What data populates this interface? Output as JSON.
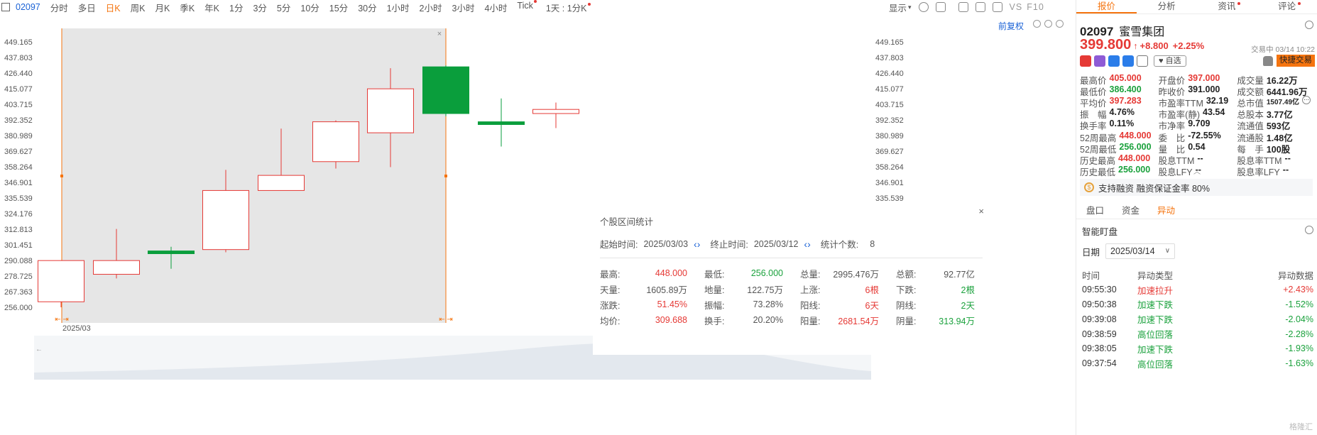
{
  "toolbar": {
    "stock_code": "02097",
    "periods": [
      "分时",
      "多日",
      "日K",
      "周K",
      "月K",
      "季K",
      "年K",
      "1分",
      "3分",
      "5分",
      "10分",
      "15分",
      "30分",
      "1小时",
      "2小时",
      "3小时",
      "4小时",
      "Tick",
      "1天 : 1分K"
    ],
    "active_period": "日K",
    "display_label": "显示",
    "vs_label": "VS",
    "f10_label": "F10"
  },
  "chart": {
    "front_adjust_label": "前复权",
    "date_label": "2025/03",
    "close_symbol": "×"
  },
  "chart_data": {
    "type": "candlestick",
    "y_ticks": [
      "449.165",
      "437.803",
      "426.440",
      "415.077",
      "403.715",
      "392.352",
      "380.989",
      "369.627",
      "358.264",
      "346.901",
      "335.539",
      "324.176",
      "312.813",
      "301.451",
      "290.088",
      "278.725",
      "267.363",
      "256.000"
    ],
    "ylim": [
      256.0,
      449.165
    ],
    "x_label": "2025/03",
    "selection": {
      "start_index": 0,
      "end_index": 8
    },
    "candles": [
      {
        "open": 260.0,
        "close": 290.0,
        "high": 290.0,
        "low": 256.0,
        "direction": "up"
      },
      {
        "open": 280.0,
        "close": 290.0,
        "high": 313.0,
        "low": 277.0,
        "direction": "up"
      },
      {
        "open": 297.0,
        "close": 295.0,
        "high": 300.0,
        "low": 284.0,
        "direction": "down"
      },
      {
        "open": 298.0,
        "close": 341.0,
        "high": 356.0,
        "low": 296.0,
        "direction": "up"
      },
      {
        "open": 341.0,
        "close": 352.0,
        "high": 386.0,
        "low": 341.0,
        "direction": "up"
      },
      {
        "open": 362.0,
        "close": 391.0,
        "high": 392.0,
        "low": 357.0,
        "direction": "up"
      },
      {
        "open": 383.0,
        "close": 415.0,
        "high": 430.0,
        "low": 358.0,
        "direction": "up"
      },
      {
        "open": 431.0,
        "close": 397.0,
        "high": 432.0,
        "low": 395.0,
        "direction": "down"
      },
      {
        "open": 391.0,
        "close": 389.0,
        "high": 408.0,
        "low": 373.0,
        "direction": "down"
      },
      {
        "open": 397.0,
        "close": 400.0,
        "high": 405.0,
        "low": 386.4,
        "direction": "up"
      }
    ]
  },
  "stats": {
    "title": "个股区间统计",
    "close_symbol": "×",
    "start_label": "起始时间:",
    "start_value": "2025/03/03",
    "end_label": "终止时间:",
    "end_value": "2025/03/12",
    "count_label": "统计个数:",
    "count_value": "8",
    "rows": [
      [
        {
          "label": "最高:",
          "value": "448.000",
          "color": "red"
        },
        {
          "label": "最低:",
          "value": "256.000",
          "color": "green"
        },
        {
          "label": "总量:",
          "value": "2995.476万",
          "color": "normal"
        },
        {
          "label": "总额:",
          "value": "92.77亿",
          "color": "normal"
        }
      ],
      [
        {
          "label": "天量:",
          "value": "1605.89万",
          "color": "normal"
        },
        {
          "label": "地量:",
          "value": "122.75万",
          "color": "normal"
        },
        {
          "label": "上涨:",
          "value": "6根",
          "color": "red"
        },
        {
          "label": "下跌:",
          "value": "2根",
          "color": "green"
        }
      ],
      [
        {
          "label": "涨跌:",
          "value": "51.45%",
          "color": "red"
        },
        {
          "label": "振幅:",
          "value": "73.28%",
          "color": "normal"
        },
        {
          "label": "阳线:",
          "value": "6天",
          "color": "red"
        },
        {
          "label": "阴线:",
          "value": "2天",
          "color": "green"
        }
      ],
      [
        {
          "label": "均价:",
          "value": "309.688",
          "color": "red"
        },
        {
          "label": "换手:",
          "value": "20.20%",
          "color": "normal"
        },
        {
          "label": "阳量:",
          "value": "2681.54万",
          "color": "red"
        },
        {
          "label": "阴量:",
          "value": "313.94万",
          "color": "green"
        }
      ]
    ]
  },
  "panel": {
    "tabs": [
      {
        "label": "报价",
        "active": true,
        "dot": false
      },
      {
        "label": "分析",
        "active": false,
        "dot": false
      },
      {
        "label": "资讯",
        "active": false,
        "dot": true
      },
      {
        "label": "评论",
        "active": false,
        "dot": true
      }
    ],
    "code": "02097",
    "name": "蜜雪集团",
    "price": "399.800",
    "arrow": "↑",
    "change": "+8.800",
    "change_pct": "+2.25%",
    "trade_status": "交易中 03/14 10:22",
    "watch_label": "♥ 自选",
    "quick_trade_label": "快捷交易",
    "quotes": [
      [
        {
          "l": "最高价",
          "v": "405.000",
          "c": "red"
        },
        {
          "l": "开盘价",
          "v": "397.000",
          "c": "red"
        },
        {
          "l": "成交量",
          "v": "16.22万",
          "c": "normal"
        }
      ],
      [
        {
          "l": "最低价",
          "v": "386.400",
          "c": "green"
        },
        {
          "l": "昨收价",
          "v": "391.000",
          "c": "normal"
        },
        {
          "l": "成交额",
          "v": "6441.96万",
          "c": "normal"
        }
      ],
      [
        {
          "l": "平均价",
          "v": "397.283",
          "c": "red"
        },
        {
          "l": "市盈率TTM",
          "v": "32.19",
          "c": "normal"
        },
        {
          "l": "总市值",
          "v": "1507.49亿",
          "c": "small"
        }
      ],
      [
        {
          "l": "振　幅",
          "v": "4.76%",
          "c": "normal"
        },
        {
          "l": "市盈率(静)",
          "v": "43.54",
          "c": "normal"
        },
        {
          "l": "总股本",
          "v": "3.77亿",
          "c": "normal"
        }
      ],
      [
        {
          "l": "换手率",
          "v": "0.11%",
          "c": "normal"
        },
        {
          "l": "市净率",
          "v": "9.709",
          "c": "normal"
        },
        {
          "l": "流通值",
          "v": "593亿",
          "c": "normal"
        }
      ],
      [
        {
          "l": "52周最高",
          "v": "448.000",
          "c": "red"
        },
        {
          "l": "委　比",
          "v": "-72.55%",
          "c": "normal"
        },
        {
          "l": "流通股",
          "v": "1.48亿",
          "c": "normal"
        }
      ],
      [
        {
          "l": "52周最低",
          "v": "256.000",
          "c": "green"
        },
        {
          "l": "量　比",
          "v": "0.54",
          "c": "normal"
        },
        {
          "l": "每　手",
          "v": "100股",
          "c": "normal"
        }
      ],
      [
        {
          "l": "历史最高",
          "v": "448.000",
          "c": "red"
        },
        {
          "l": "股息TTM",
          "v": "--",
          "c": "normal"
        },
        {
          "l": "股息率TTM",
          "v": "--",
          "c": "normal"
        }
      ],
      [
        {
          "l": "历史最低",
          "v": "256.000",
          "c": "green"
        },
        {
          "l": "股息LFY",
          "v": "--",
          "c": "normal"
        },
        {
          "l": "股息率LFY",
          "v": "--",
          "c": "normal"
        }
      ]
    ],
    "margin_text": "支持融资 融资保证金率 80%",
    "subtabs": [
      {
        "label": "盘口",
        "active": false
      },
      {
        "label": "资金",
        "active": false
      },
      {
        "label": "异动",
        "active": true
      }
    ],
    "smart_title": "智能盯盘",
    "date_label": "日期",
    "date_value": "2025/03/14",
    "alert_headers": {
      "time": "时间",
      "type": "异动类型",
      "data": "异动数据"
    },
    "alerts": [
      {
        "time": "09:55:30",
        "type": "加速拉升",
        "data": "+2.43%",
        "dir": "up"
      },
      {
        "time": "09:50:38",
        "type": "加速下跌",
        "data": "-1.52%",
        "dir": "down"
      },
      {
        "time": "09:39:08",
        "type": "加速下跌",
        "data": "-2.04%",
        "dir": "down"
      },
      {
        "time": "09:38:59",
        "type": "高位回落",
        "data": "-2.28%",
        "dir": "down"
      },
      {
        "time": "09:38:05",
        "type": "加速下跌",
        "data": "-1.93%",
        "dir": "down"
      },
      {
        "time": "09:37:54",
        "type": "高位回落",
        "data": "-1.63%",
        "dir": "down"
      }
    ],
    "watermark": "格隆汇"
  },
  "colors": {
    "up": "#e53935",
    "down": "#0a9e3c",
    "accent": "#f5740f",
    "link": "#1a62d6"
  }
}
